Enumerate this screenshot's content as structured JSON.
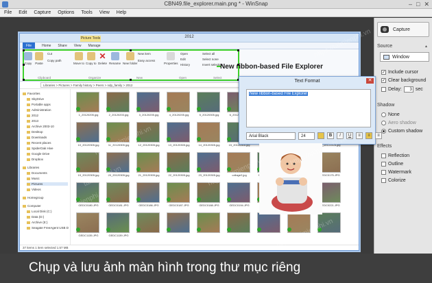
{
  "window": {
    "title": "CBN49.file_explorer.main.png * - WinSnap",
    "controls": [
      "–",
      "□",
      "✕"
    ]
  },
  "menu": [
    "File",
    "Edit",
    "Capture",
    "Options",
    "Tools",
    "View",
    "Help"
  ],
  "panel": {
    "capture_label": "Capture",
    "source_heading": "Source",
    "source_value": "Window",
    "include_cursor": "Include cursor",
    "clear_background": "Clear background",
    "delay_label": "Delay:",
    "delay_value": "3",
    "delay_unit": "sec",
    "shadow_heading": "Shadow",
    "shadow_none": "None",
    "shadow_aero": "Aero shadow",
    "shadow_custom": "Custom shadow",
    "effects_heading": "Effects",
    "effect_reflection": "Reflection",
    "effect_outline": "Outline",
    "effect_watermark": "Watermark",
    "effect_colorize": "Colorize"
  },
  "explorer": {
    "title": "2012",
    "picture_tools": "Picture Tools",
    "tabs": [
      "File",
      "Home",
      "Share",
      "View",
      "Manage"
    ],
    "ribbon_buttons": [
      "Copy",
      "Paste",
      "Cut",
      "Copy path",
      "Move to",
      "Copy to",
      "Delete",
      "Rename",
      "New folder",
      "New item",
      "Easy access",
      "Properties",
      "Open",
      "Edit",
      "History",
      "Select all",
      "Select none",
      "Invert selection"
    ],
    "ribbon_groups": [
      "Clipboard",
      "Organize",
      "New",
      "Open",
      "Select"
    ],
    "address": "Libraries > Pictures > Family history > Peers > ndp_family > 2012",
    "search_placeholder": "Search 2012",
    "nav": [
      "Favorites",
      "SkyDrive",
      "Portable apps",
      "Administration",
      "2012",
      "2013",
      "Archive 2003-10",
      "Desktop",
      "Downloads",
      "Recent places",
      "SpiderOak Hive",
      "Google Drive",
      "Dropbox",
      "Libraries",
      "Documents",
      "Music",
      "Pictures",
      "Videos",
      "Homegroup",
      "Computer",
      "Local Disk (C:)",
      "Data (D:)",
      "Archive (E:)",
      "Seagate FreeAgent USB D"
    ],
    "thumbs": [
      "1_20120205.jpg",
      "2_20120203.jpg",
      "3_20120205.jpg",
      "4_20120205.jpg",
      "5_20120305.jpg",
      "6_20120305.jpg",
      "7_20120305.jpg",
      "8_20120305.jpg",
      "9_20120305.jpg",
      "10_20120305.jpg",
      "11_20120305.jpg",
      "12_20120305.jpg",
      "13_20120305.jpg",
      "14_20120305.jpg",
      "15_20120305.jpg",
      "16_20120305.jpg",
      "17_20120305.jpg",
      "18_20120305.jpg",
      "19_20120305.jpg",
      "20_20120305.jpg",
      "21_20120305.jpg",
      "22_20120305.jpg",
      "23_20120305.jpg",
      "collage2.jpg",
      "family_100806.jpg",
      "GEDC0171.JPG",
      "GEDC0175.JPG",
      "GEDC0180.JPG",
      "GEDC0181.JPG",
      "GEDC0186.JPG",
      "GEDC0187.JPG",
      "GEDC0188.JPG",
      "GEDC0194.JPG",
      "GEDC0200.JPG",
      "GEDC0206.JPG",
      "GEDC0221.JPG",
      "GEDC1135.JPG",
      "GEDC1139.JPG",
      "",
      "",
      "",
      "",
      "",
      "",
      ""
    ],
    "status": "37 items   1 item selected   1.57 MB"
  },
  "annotation": "New ribbon-based File Explorer",
  "text_format": {
    "title": "Text Format",
    "text": "New ribbon-based File Explorer",
    "font": "Arial Black",
    "size": "24",
    "buttons": [
      "B",
      "I",
      "U"
    ]
  },
  "caption": "Chụp và lưu ảnh màn hình trong thư mục riêng",
  "watermarks": [
    "https://taimienphi.vn",
    "https://taimienphi.vn",
    "taimienphi.vn",
    "https://taimienphi.vn",
    "https://taimienphi.vn",
    "https://taimienphi.vn",
    "taimienphi.vn",
    "https://taimienphi.vn"
  ],
  "colors": {
    "highlight_green": "#3ed12b",
    "accent_blue": "#2a6fd0",
    "selection": "#3d7fd7"
  }
}
